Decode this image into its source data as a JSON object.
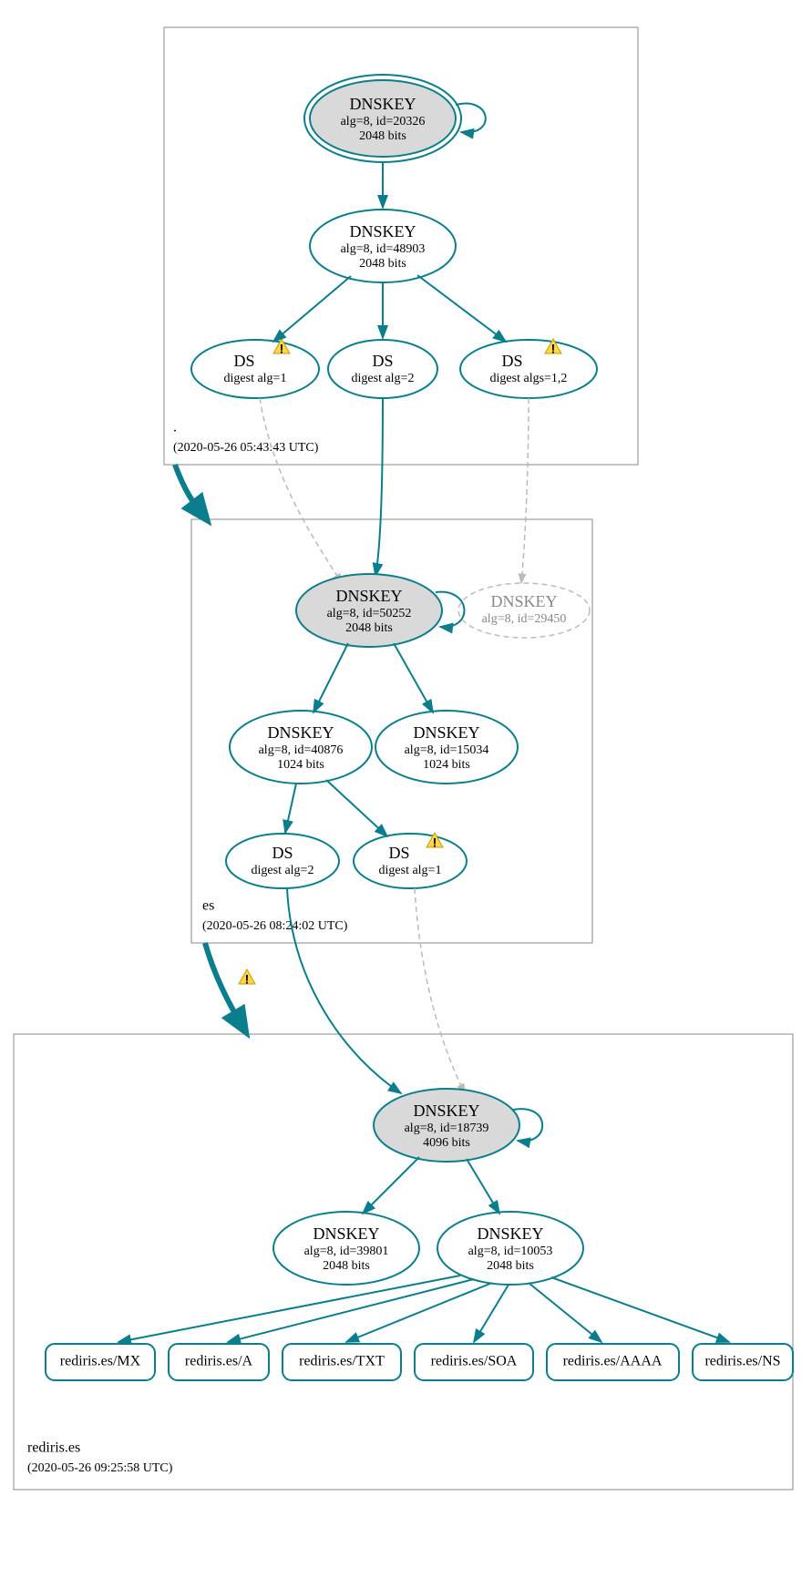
{
  "zones": {
    "root": {
      "name": ".",
      "time": "(2020-05-26 05:43:43 UTC)"
    },
    "es": {
      "name": "es",
      "time": "(2020-05-26 08:24:02 UTC)"
    },
    "rediris": {
      "name": "rediris.es",
      "time": "(2020-05-26 09:25:58 UTC)"
    }
  },
  "nodes": {
    "root_ksk": {
      "t": "DNSKEY",
      "l2": "alg=8, id=20326",
      "l3": "2048 bits"
    },
    "root_zsk": {
      "t": "DNSKEY",
      "l2": "alg=8, id=48903",
      "l3": "2048 bits"
    },
    "root_ds1": {
      "t": "DS",
      "l2": "digest alg=1",
      "warn": true
    },
    "root_ds2": {
      "t": "DS",
      "l2": "digest alg=2"
    },
    "root_ds12": {
      "t": "DS",
      "l2": "digest algs=1,2",
      "warn": true
    },
    "es_ksk": {
      "t": "DNSKEY",
      "l2": "alg=8, id=50252",
      "l3": "2048 bits"
    },
    "es_dashed": {
      "t": "DNSKEY",
      "l2": "alg=8, id=29450"
    },
    "es_zsk1": {
      "t": "DNSKEY",
      "l2": "alg=8, id=40876",
      "l3": "1024 bits"
    },
    "es_zsk2": {
      "t": "DNSKEY",
      "l2": "alg=8, id=15034",
      "l3": "1024 bits"
    },
    "es_ds2": {
      "t": "DS",
      "l2": "digest alg=2"
    },
    "es_ds1": {
      "t": "DS",
      "l2": "digest alg=1",
      "warn": true
    },
    "red_ksk": {
      "t": "DNSKEY",
      "l2": "alg=8, id=18739",
      "l3": "4096 bits"
    },
    "red_zsk1": {
      "t": "DNSKEY",
      "l2": "alg=8, id=39801",
      "l3": "2048 bits"
    },
    "red_zsk2": {
      "t": "DNSKEY",
      "l2": "alg=8, id=10053",
      "l3": "2048 bits"
    }
  },
  "rrsets": [
    "rediris.es/MX",
    "rediris.es/A",
    "rediris.es/TXT",
    "rediris.es/SOA",
    "rediris.es/AAAA",
    "rediris.es/NS"
  ]
}
